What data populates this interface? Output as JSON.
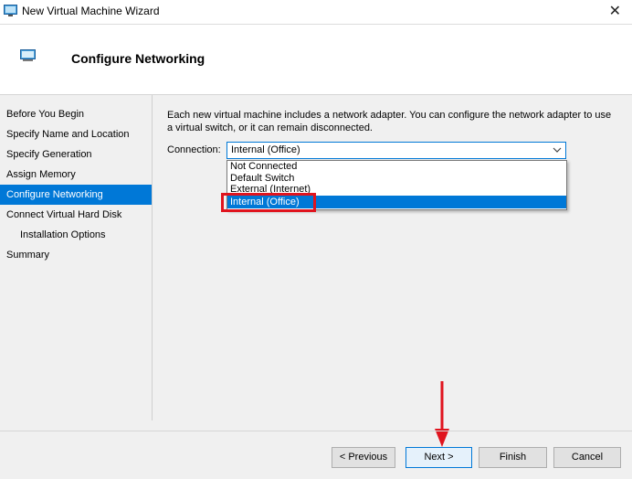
{
  "window": {
    "title": "New Virtual Machine Wizard",
    "close_glyph": "✕"
  },
  "header": {
    "title": "Configure Networking"
  },
  "nav": {
    "items": [
      {
        "label": "Before You Begin"
      },
      {
        "label": "Specify Name and Location"
      },
      {
        "label": "Specify Generation"
      },
      {
        "label": "Assign Memory"
      },
      {
        "label": "Configure Networking",
        "active": true
      },
      {
        "label": "Connect Virtual Hard Disk"
      },
      {
        "label": "Installation Options",
        "sub": true
      },
      {
        "label": "Summary"
      }
    ]
  },
  "main": {
    "description": "Each new virtual machine includes a network adapter. You can configure the network adapter to use a virtual switch, or it can remain disconnected.",
    "connection_label": "Connection:",
    "connection_value": "Internal (Office)",
    "options": [
      "Not Connected",
      "Default Switch",
      "External (Internet)",
      "Internal (Office)"
    ],
    "selected_index": 3
  },
  "buttons": {
    "previous": "< Previous",
    "next": "Next >",
    "finish": "Finish",
    "cancel": "Cancel"
  },
  "colors": {
    "accent": "#0078d7",
    "annotation_red": "#e0141e"
  }
}
